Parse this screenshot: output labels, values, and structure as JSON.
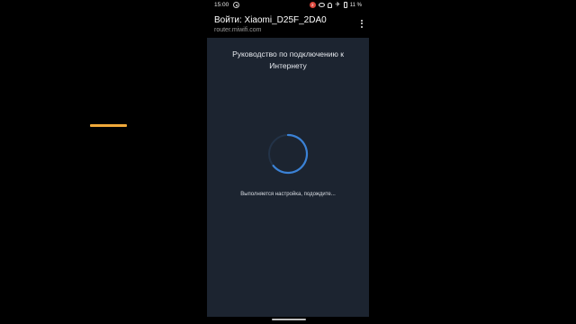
{
  "status_bar": {
    "time": "15:00",
    "notification_count": "2",
    "battery_text": "11 %"
  },
  "header": {
    "title": "Войти: Xiaomi_D25F_2DA0",
    "url": "router.miwifi.com"
  },
  "content": {
    "guide_title": "Руководство по подключению к Интернету",
    "loading_text": "Выполняется настройка, подождите..."
  },
  "colors": {
    "side_accent": "#f0a93a",
    "content_background": "#1c2430",
    "spinner": "#3b82d6"
  },
  "icons": {
    "status_left": "location-icon",
    "notification": "notification-badge",
    "eye": "eye-icon",
    "bell_off": "bell-off-icon",
    "airplane": "airplane-icon",
    "battery": "battery-icon",
    "menu": "more-vertical-icon",
    "spinner": "spinner-icon"
  }
}
